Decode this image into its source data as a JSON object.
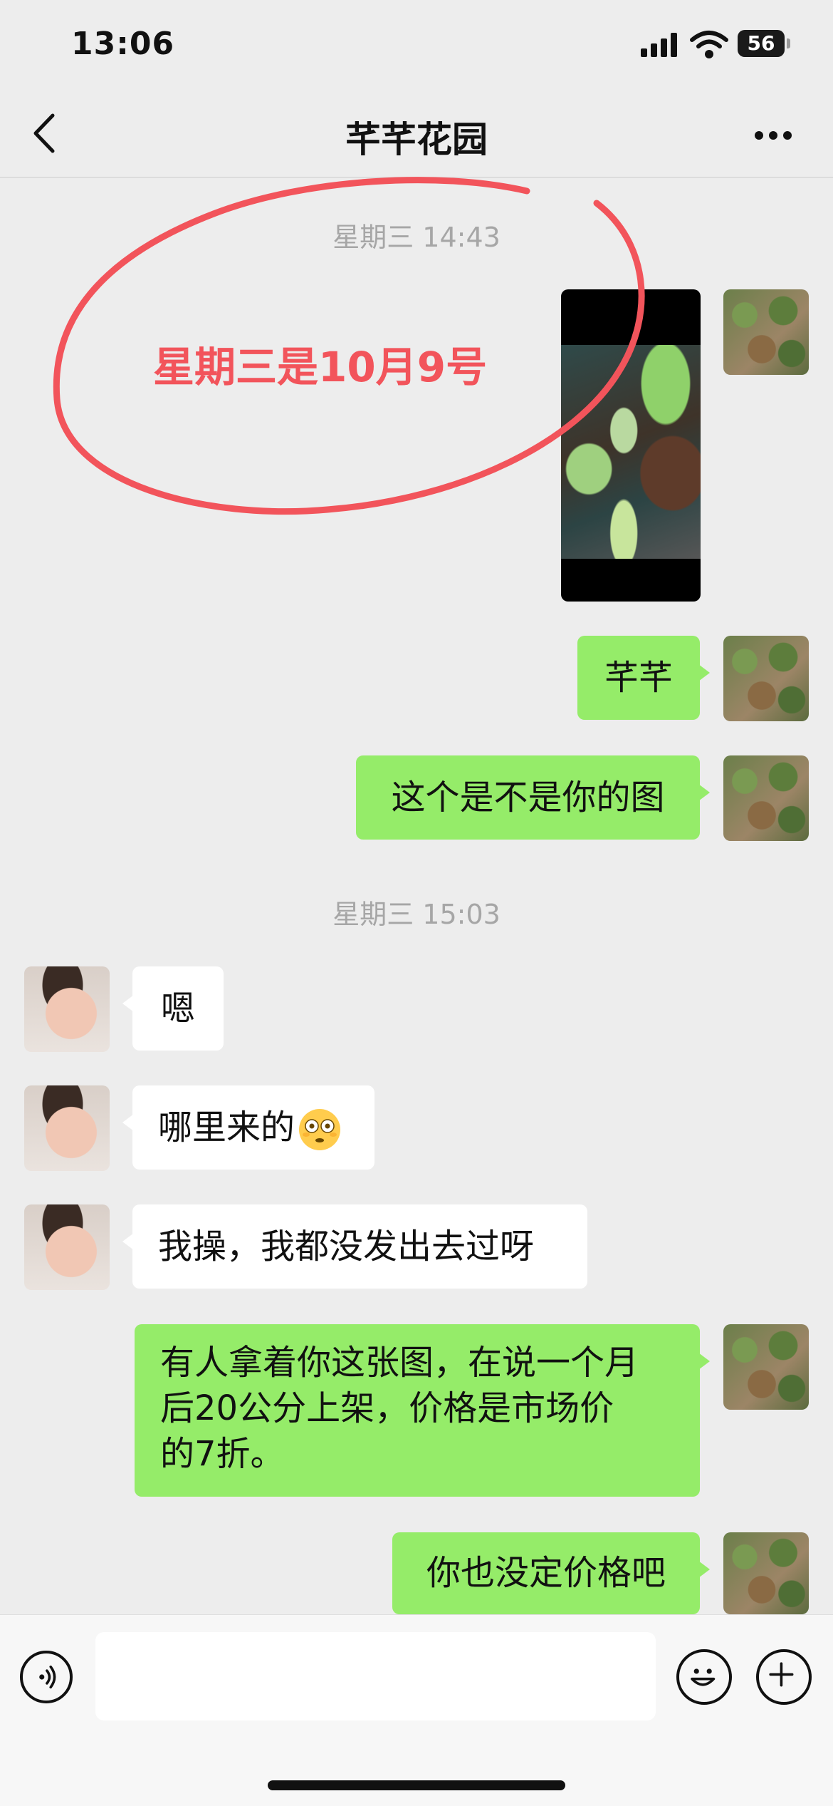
{
  "status_bar": {
    "time": "13:06",
    "battery": "56"
  },
  "header": {
    "title": "芊芊花园"
  },
  "annotation": {
    "text": "星期三是10月9号",
    "color": "#f2545b"
  },
  "messages": [
    {
      "type": "timestamp",
      "text": "星期三 14:43"
    },
    {
      "type": "image",
      "from": "me"
    },
    {
      "type": "text",
      "from": "me",
      "text": "芊芊"
    },
    {
      "type": "text",
      "from": "me",
      "text": "这个是不是你的图"
    },
    {
      "type": "timestamp",
      "text": "星期三 15:03"
    },
    {
      "type": "text",
      "from": "them",
      "text": "嗯"
    },
    {
      "type": "text",
      "from": "them",
      "text": "哪里来的",
      "emoji": "flushed-face"
    },
    {
      "type": "text",
      "from": "them",
      "text": "我操，我都没发出去过呀"
    },
    {
      "type": "text",
      "from": "me",
      "lines": [
        "有人拿着你这张图，在说一个月",
        "后20公分上架，价格是市场价",
        "的7折。"
      ]
    },
    {
      "type": "text",
      "from": "me",
      "text": "你也没定价格吧"
    }
  ],
  "input": {
    "value": ""
  },
  "colors": {
    "my_bubble": "#95ec69",
    "their_bubble": "#ffffff",
    "background": "#ededed"
  }
}
